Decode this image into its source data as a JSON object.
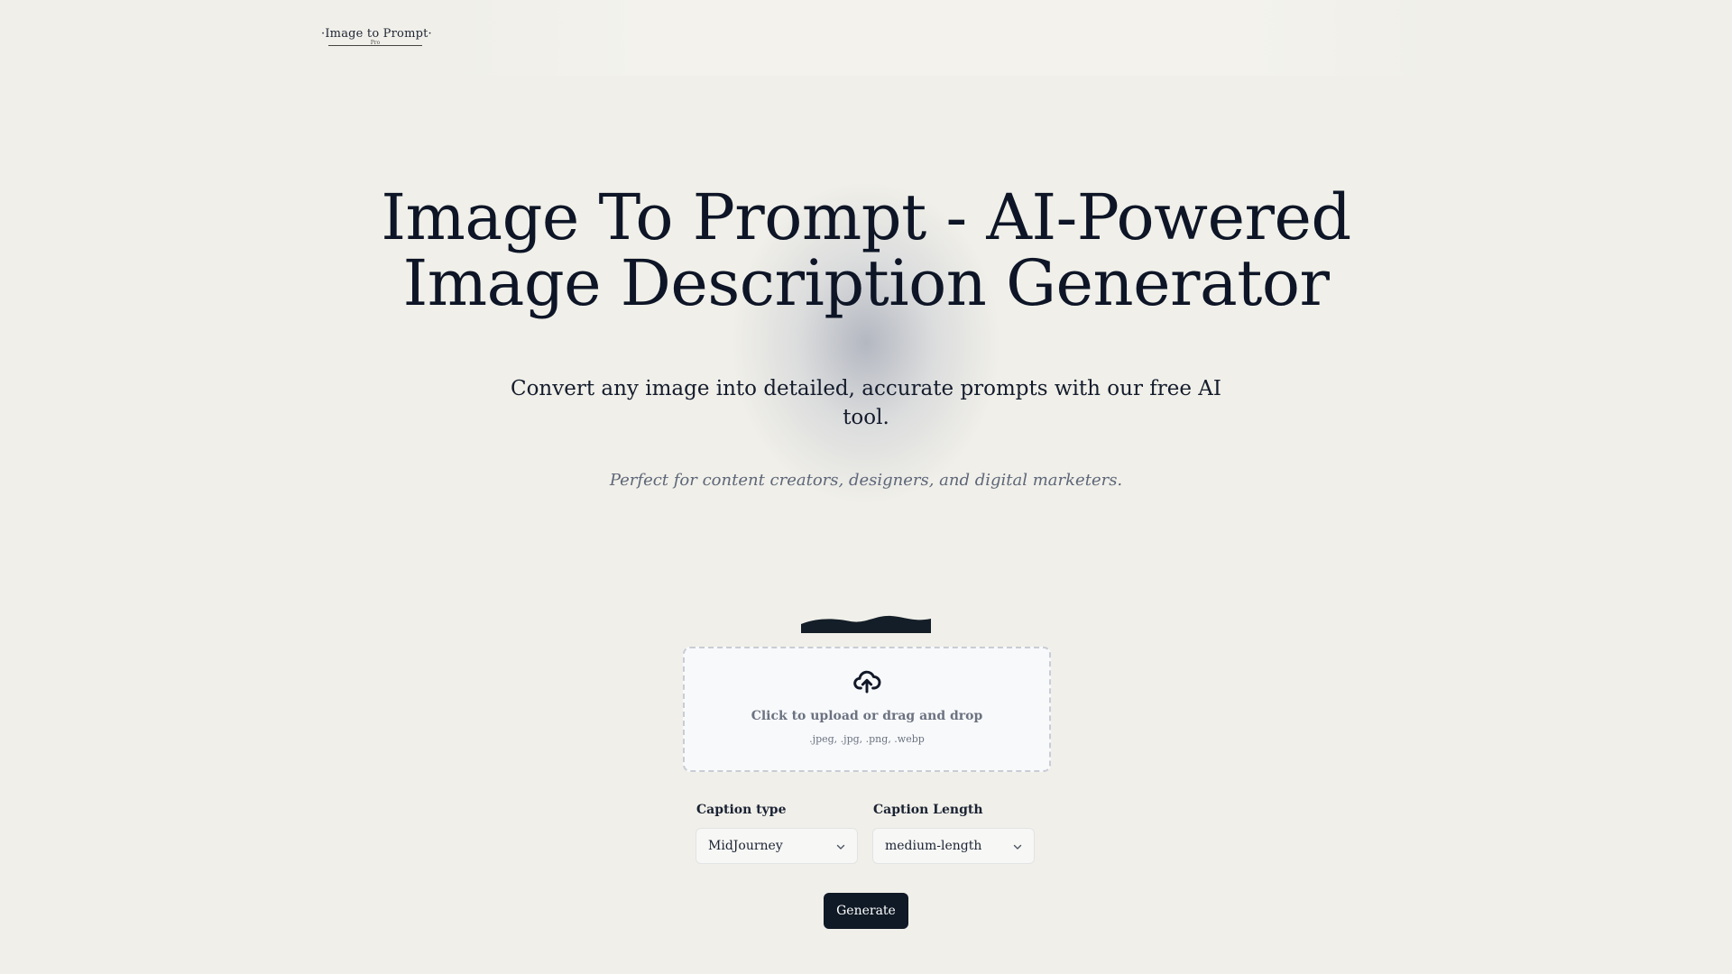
{
  "header": {
    "logo": {
      "main": "·Image to Prompt·",
      "sub": "Pro"
    }
  },
  "hero": {
    "title_line1": "Image To Prompt - AI-Powered",
    "title_line2": "Image Description Generator",
    "subtitle": "Convert any image into detailed, accurate prompts with our free AI tool.",
    "tagline": "Perfect for content creators, designers, and digital marketers."
  },
  "upload": {
    "icon": "cloud-upload-icon",
    "label": "Click to upload or drag and drop",
    "formats": ".jpeg, .jpg, .png, .webp"
  },
  "options": {
    "caption_type": {
      "label": "Caption type",
      "value": "MidJourney"
    },
    "caption_length": {
      "label": "Caption Length",
      "value": "medium-length"
    }
  },
  "actions": {
    "generate_label": "Generate"
  },
  "colors": {
    "background": "#f0efe9",
    "primary": "#101a26",
    "muted_text": "#6b7280"
  }
}
